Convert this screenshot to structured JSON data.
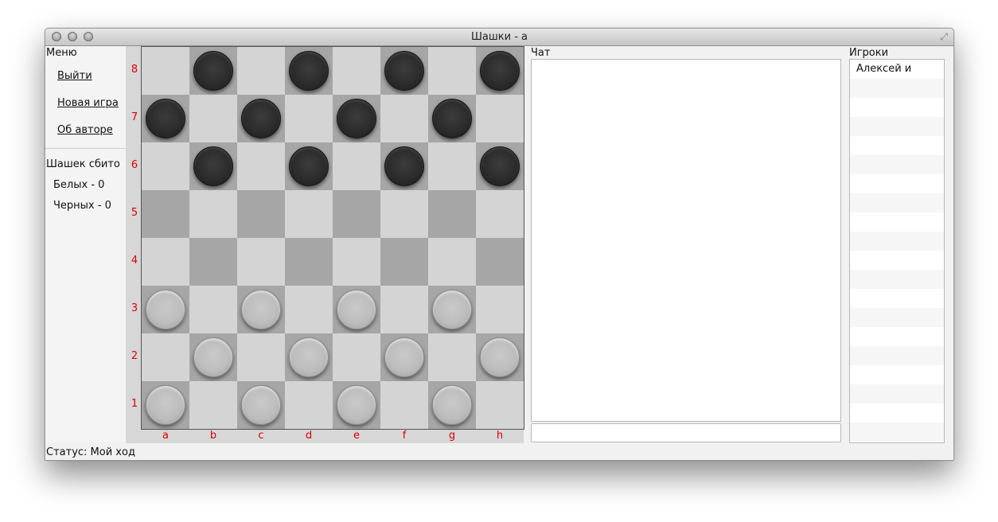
{
  "window": {
    "title": "Шашки - a"
  },
  "menu": {
    "heading": "Меню",
    "items": [
      {
        "label": "Выйти"
      },
      {
        "label": "Новая игра"
      },
      {
        "label": "Об авторе"
      }
    ]
  },
  "captured": {
    "heading": "Шашек сбито",
    "white": "Белых - 0",
    "black": "Черных - 0"
  },
  "board": {
    "ranks": [
      "8",
      "7",
      "6",
      "5",
      "4",
      "3",
      "2",
      "1"
    ],
    "files": [
      "a",
      "b",
      "c",
      "d",
      "e",
      "f",
      "g",
      "h"
    ],
    "pieces": [
      [
        "",
        "b",
        "",
        "b",
        "",
        "b",
        "",
        "b"
      ],
      [
        "b",
        "",
        "b",
        "",
        "b",
        "",
        "b",
        ""
      ],
      [
        "",
        "b",
        "",
        "b",
        "",
        "b",
        "",
        "b"
      ],
      [
        "",
        "",
        "",
        "",
        "",
        "",
        "",
        ""
      ],
      [
        "",
        "",
        "",
        "",
        "",
        "",
        "",
        ""
      ],
      [
        "w",
        "",
        "w",
        "",
        "w",
        "",
        "w",
        ""
      ],
      [
        "",
        "w",
        "",
        "w",
        "",
        "w",
        "",
        "w"
      ],
      [
        "w",
        "",
        "w",
        "",
        "w",
        "",
        "w",
        ""
      ]
    ],
    "colors": {
      "light": "#d4d4d4",
      "dark": "#a6a6a6",
      "label": "#e00000"
    }
  },
  "chat": {
    "heading": "Чат",
    "input_value": ""
  },
  "players": {
    "heading": "Игроки",
    "list": [
      "Алексей и"
    ]
  },
  "status": {
    "text": "Статус: Мой ход"
  }
}
